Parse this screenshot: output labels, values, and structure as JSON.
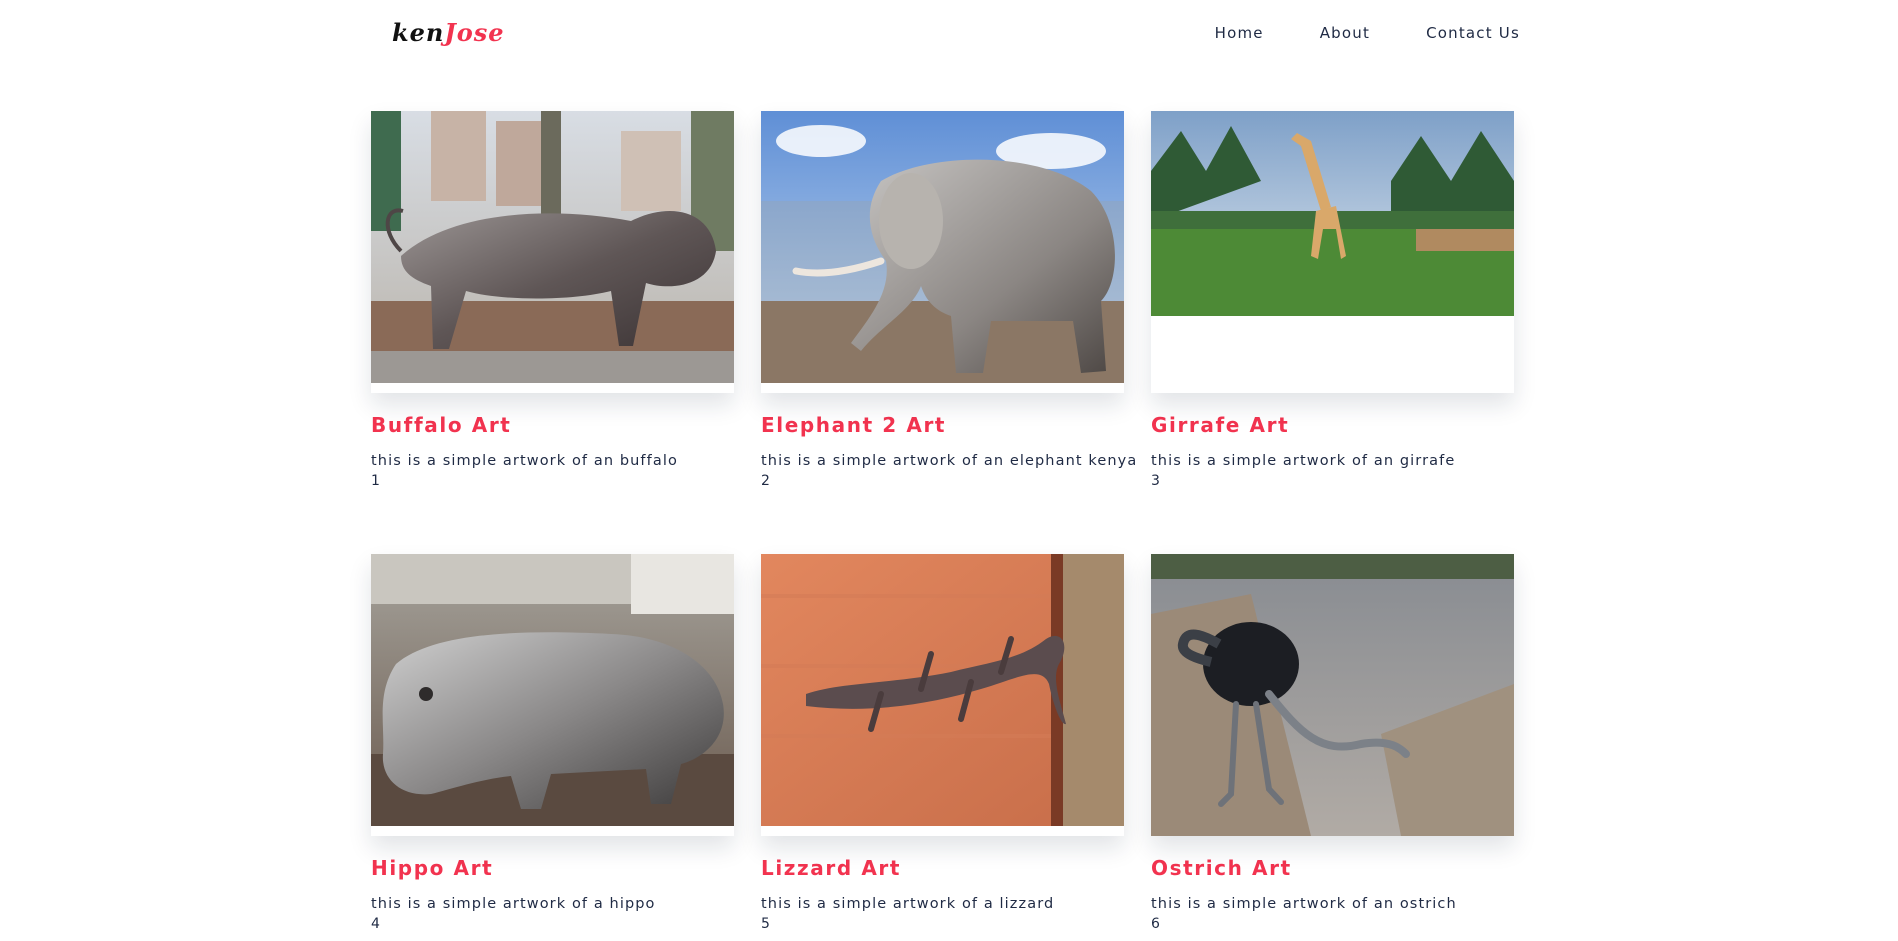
{
  "brand": {
    "part1": "ken",
    "part2": "Jose"
  },
  "nav": {
    "links": [
      "Home",
      "About",
      "Contact Us"
    ]
  },
  "colors": {
    "accent": "#f2334f",
    "text": "#1f2a44",
    "background": "#ffffff"
  },
  "gallery": {
    "items": [
      {
        "title": "Buffalo Art",
        "description": "this is a simple artwork of an buffalo",
        "number": "1",
        "image": "buffalo-sculpture"
      },
      {
        "title": "Elephant 2 Art",
        "description": "this is a simple artwork of an elephant kenya",
        "number": "2",
        "image": "elephant-sculpture"
      },
      {
        "title": "Girrafe Art",
        "description": "this is a simple artwork of an girrafe",
        "number": "3",
        "image": "giraffe-sculpture"
      },
      {
        "title": "Hippo Art",
        "description": "this is a simple artwork of a hippo",
        "number": "4",
        "image": "hippo-sculpture"
      },
      {
        "title": "Lizzard Art",
        "description": "this is a simple artwork of a lizzard",
        "number": "5",
        "image": "lizard-sculpture"
      },
      {
        "title": "Ostrich Art",
        "description": "this is a simple artwork of an ostrich",
        "number": "6",
        "image": "ostrich-sculpture"
      }
    ]
  }
}
